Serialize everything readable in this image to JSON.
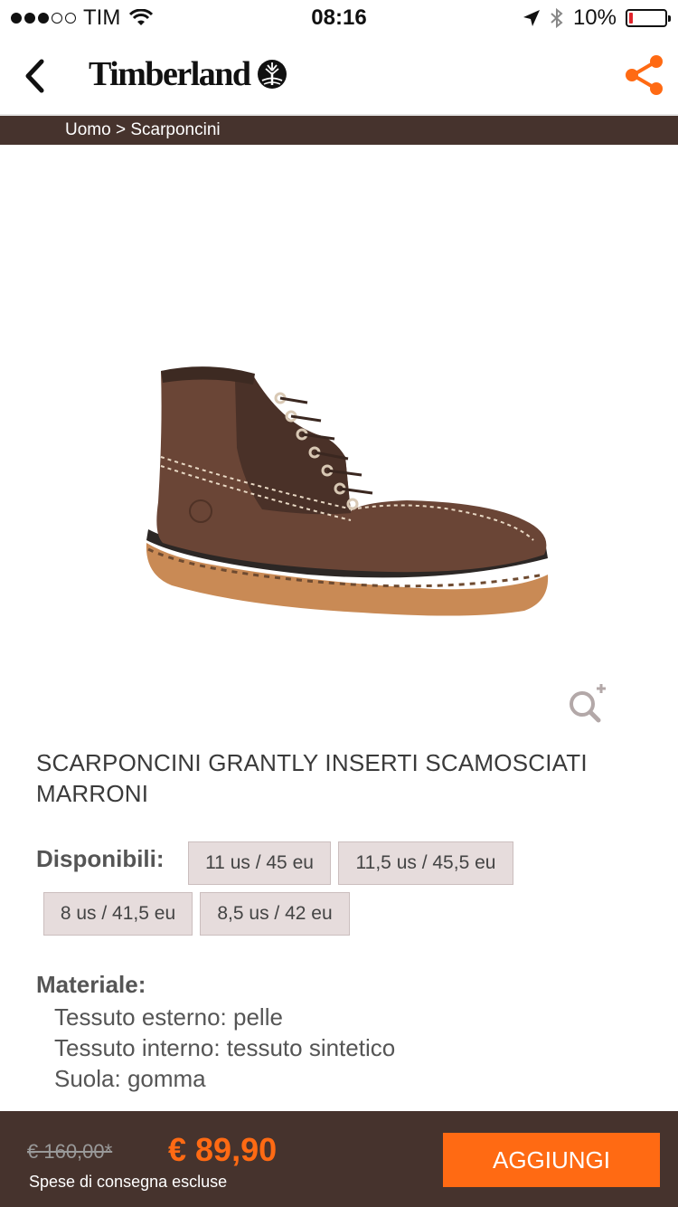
{
  "status_bar": {
    "carrier": "TIM",
    "time": "08:16",
    "battery": "10%",
    "battery_level": 0.1
  },
  "nav": {
    "logo_text": "Timberland",
    "back_icon": "chevron-left-icon",
    "share_icon": "share-icon",
    "accent_color": "#ff6a13"
  },
  "breadcrumb": {
    "text": "Uomo > Scarponcini"
  },
  "product": {
    "title": "SCARPONCINI GRANTLY INSERTI SCAMOSCIATI MARRONI",
    "zoom_icon": "zoom-in-icon"
  },
  "sizes": {
    "label": "Disponibili:",
    "options": [
      "11 us / 45 eu",
      "11,5 us / 45,5 eu",
      "8 us / 41,5 eu",
      "8,5 us / 42 eu"
    ]
  },
  "materials": {
    "label": "Materiale:",
    "items": [
      "Tessuto esterno: pelle",
      "Tessuto interno: tessuto sintetico",
      "Suola: gomma"
    ]
  },
  "purchase": {
    "old_price": "€ 160,00*",
    "price": "€ 89,90",
    "shipping_note": "Spese di consegna escluse",
    "add_button": "AGGIUNGI",
    "bar_color": "#46332d"
  }
}
